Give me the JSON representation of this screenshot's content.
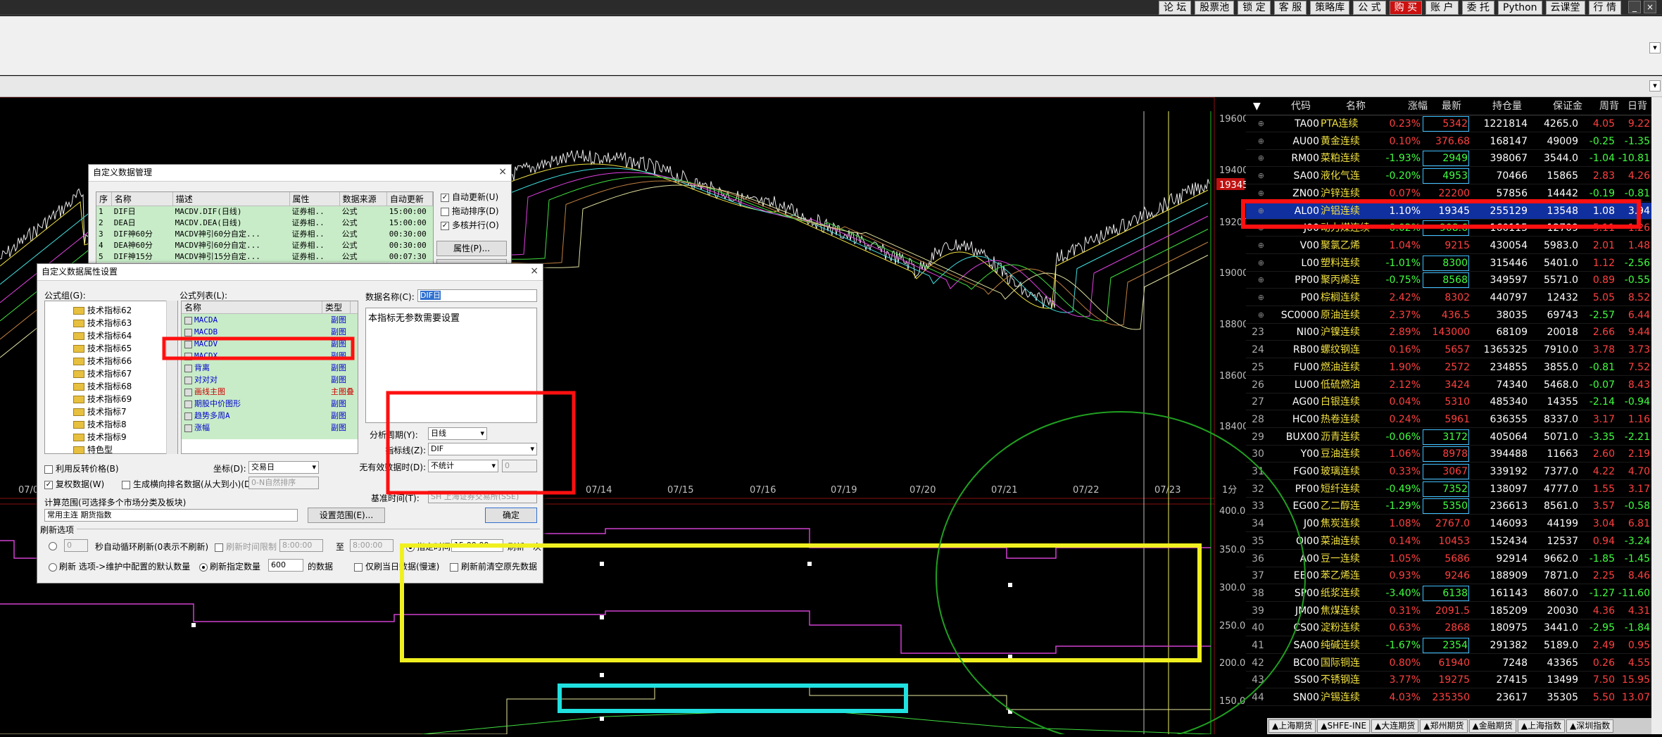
{
  "topbar": {
    "buttons": [
      "论 坛",
      "股票池",
      "锁 定",
      "客 服",
      "策略库",
      "公 式",
      "购 买",
      "账 户",
      "委 托",
      "Python",
      "云课堂",
      "行 情"
    ],
    "highlight": "购 买"
  },
  "chart": {
    "price_axis": [
      "19600",
      "19400",
      "19345",
      "19200",
      "19000",
      "18800",
      "18600",
      "18400"
    ],
    "current_price": "19345",
    "date_labels": [
      "07/05",
      "07/14",
      "07/15",
      "07/16",
      "07/19",
      "07/20",
      "07/21",
      "07/22",
      "07/23"
    ],
    "axis_unit": "1分",
    "indicator_axis": [
      "400.0",
      "350.0",
      "300.0",
      "250.0",
      "200.0",
      "150.0"
    ]
  },
  "dialog_main": {
    "title": "自定义数据管理",
    "columns": [
      "序",
      "名称",
      "描述",
      "属性",
      "数据来源",
      "自动更新"
    ],
    "rows": [
      [
        "1",
        "DIF日",
        "MACDV.DIF(日线)",
        "证券相..",
        "公式",
        "15:00:00"
      ],
      [
        "2",
        "DEA日",
        "MACDV.DEA(日线)",
        "证券相..",
        "公式",
        "15:00:00"
      ],
      [
        "3",
        "DIF神60分",
        "MACDV神引60分自定...",
        "证券相..",
        "公式",
        "00:30:00"
      ],
      [
        "4",
        "DEA神60分",
        "MACDV神引60分自定...",
        "证券相..",
        "公式",
        "00:30:00"
      ],
      [
        "5",
        "DIF神15分",
        "MACDV神引15分自定...",
        "证券相..",
        "公式",
        "00:07:30"
      ]
    ],
    "options": [
      {
        "label": "自动更新(U)",
        "checked": true
      },
      {
        "label": "拖动排序(D)",
        "checked": false
      },
      {
        "label": "多核并行(O)",
        "checked": true
      }
    ],
    "prop_button": "属性(P)..."
  },
  "dialog_prop": {
    "title": "自定义数据属性设置",
    "group_label": "公式组(G):",
    "tree": [
      "技术指标62",
      "技术指标63",
      "技术指标64",
      "技术指标65",
      "技术指标66",
      "技术指标67",
      "技术指标68",
      "技术指标69",
      "技术指标7",
      "技术指标8",
      "技术指标9",
      "特色型"
    ],
    "formula_label": "公式列表(L):",
    "formula_cols": [
      "名称",
      "类型"
    ],
    "formulas": [
      [
        "MACDA",
        "副图"
      ],
      [
        "MACDB",
        "副图"
      ],
      [
        "MACDV",
        "副图"
      ],
      [
        "MACDX",
        "副图"
      ],
      [
        "背离",
        "副图"
      ],
      [
        "对对对",
        "副图"
      ],
      [
        "画线主图",
        "主图叠"
      ],
      [
        "期股中价图形",
        "副图"
      ],
      [
        "趋势多周A",
        "副图"
      ],
      [
        "涨幅",
        "副图"
      ]
    ],
    "data_name_label": "数据名称(C):",
    "data_name_value": "DIF日",
    "desc": "本指标无参数需要设置",
    "period_label": "分析周期(Y):",
    "period_value": "日线",
    "line_label": "指标线(Z):",
    "line_value": "DIF",
    "invalid_label": "无有效数据时(D):",
    "invalid_value": "不统计",
    "invalid_num": "0",
    "use_reverse": "利用反转价格(B)",
    "coord_label": "坐标(D):",
    "coord_value": "交易日",
    "fuquan": "复权数据(W)",
    "rank": "生成横向排名数据(从大到小)(D)",
    "rank_value": "0-N自然排序",
    "base_time_label": "基准时间(T):",
    "base_time_value": "SH 上海证券交易所(SSE)",
    "range_label": "计算范围(可选择多个市场分类及板块)",
    "range_value": "常用主连 期货指数",
    "range_button": "设置范围(E)...",
    "ok_button": "确定",
    "refresh_title": "刷新选项",
    "refresh_sec_val": "0",
    "refresh_sec": "秒自动循环刷新(0表示不刷新)",
    "time_limit": "刷新时间限制",
    "t_from": "8:00:00",
    "t_to_label": "至",
    "t_to": "8:00:00",
    "assign_time": "指定时间",
    "assign_time_val": "15:00:00",
    "assign_once": "刷新一次",
    "refresh_opt": "刷新 选项->维护中配置的默认数量",
    "refresh_count": "刷新指定数量",
    "count_val": "600",
    "count_unit": "的数据",
    "only_day": "仅刷当日数据(慢速)",
    "clear_first": "刷新前清空原先数据"
  },
  "watchlist": {
    "headers": [
      "代码",
      "名称",
      "涨幅",
      "最新",
      "持仓量",
      "保证金",
      "周背",
      "日背"
    ],
    "rows": [
      [
        "",
        "TA00",
        "PTA连续",
        "0.23%",
        "5342",
        "1221814",
        "4265.0",
        "4.05",
        "9.22"
      ],
      [
        "",
        "AU00",
        "黄金连续",
        "0.10%",
        "376.68",
        "168147",
        "49009",
        "-0.25",
        "-1.35"
      ],
      [
        "",
        "RM00",
        "菜粕连续",
        "-1.93%",
        "2949",
        "398067",
        "3544.0",
        "-1.04",
        "-10.81"
      ],
      [
        "",
        "SA00",
        "液化气连",
        "-0.20%",
        "4953",
        "70466",
        "15865",
        "2.83",
        "4.26"
      ],
      [
        "",
        "ZN00",
        "沪锌连续",
        "0.07%",
        "22200",
        "57856",
        "14442",
        "-0.19",
        "-0.81"
      ],
      [
        "",
        "AL00",
        "沪铝连续",
        "1.10%",
        "19345",
        "255129",
        "13548",
        "1.08",
        "3.94"
      ],
      [
        "",
        "J00",
        "动力煤连续",
        "-0.02%",
        "908.6",
        "160115",
        "12709",
        "5.11",
        "1.26"
      ],
      [
        "",
        "V00",
        "聚氯乙烯",
        "1.04%",
        "9215",
        "430054",
        "5983.0",
        "2.01",
        "1.48"
      ],
      [
        "",
        "L00",
        "塑料连续",
        "-1.01%",
        "8300",
        "315446",
        "5401.0",
        "1.12",
        "-2.56"
      ],
      [
        "",
        "PP00",
        "聚丙烯连",
        "-0.75%",
        "8568",
        "349597",
        "5571.0",
        "0.89",
        "-0.55"
      ],
      [
        "",
        "P00",
        "棕榈连续",
        "2.42%",
        "8302",
        "440797",
        "12432",
        "5.05",
        "8.52"
      ],
      [
        "",
        "SC0000",
        "原油连续",
        "2.37%",
        "436.5",
        "38035",
        "69743",
        "-2.57",
        "6.44"
      ],
      [
        "23",
        "NI00",
        "沪镍连续",
        "2.89%",
        "143000",
        "68109",
        "20018",
        "2.66",
        "9.44"
      ],
      [
        "24",
        "RB00",
        "螺纹钢连",
        "0.16%",
        "5657",
        "1365325",
        "7910.0",
        "3.78",
        "3.73"
      ],
      [
        "25",
        "FU00",
        "燃油连续",
        "1.90%",
        "2572",
        "234855",
        "3855.0",
        "-0.81",
        "7.52"
      ],
      [
        "26",
        "LU00",
        "低硫燃油",
        "2.12%",
        "3424",
        "74340",
        "5468.0",
        "-0.07",
        "8.43"
      ],
      [
        "27",
        "AG00",
        "白银连续",
        "0.04%",
        "5310",
        "485340",
        "14355",
        "-2.14",
        "-0.94"
      ],
      [
        "28",
        "HC00",
        "热卷连续",
        "0.24%",
        "5961",
        "636355",
        "8337.0",
        "3.17",
        "1.16"
      ],
      [
        "29",
        "BUX00",
        "沥青连续",
        "-0.06%",
        "3172",
        "405064",
        "5071.0",
        "-3.35",
        "-2.21"
      ],
      [
        "30",
        "Y00",
        "豆油连续",
        "1.06%",
        "8978",
        "394488",
        "11663",
        "2.60",
        "2.19"
      ],
      [
        "31",
        "FG00",
        "玻璃连续",
        "0.33%",
        "3067",
        "339192",
        "7377.0",
        "4.22",
        "4.70"
      ],
      [
        "32",
        "PF00",
        "短纤连续",
        "-0.49%",
        "7352",
        "138097",
        "4777.0",
        "1.55",
        "3.17"
      ],
      [
        "33",
        "EG00",
        "乙二醇连",
        "-1.29%",
        "5350",
        "236613",
        "8561.0",
        "3.57",
        "-0.58"
      ],
      [
        "34",
        "J00",
        "焦炭连续",
        "1.08%",
        "2767.0",
        "146093",
        "44199",
        "3.04",
        "6.81"
      ],
      [
        "35",
        "OI00",
        "菜油连续",
        "0.14%",
        "10453",
        "152434",
        "12537",
        "0.94",
        "-3.24"
      ],
      [
        "36",
        "A00",
        "豆一连续",
        "1.05%",
        "5686",
        "92914",
        "9662.0",
        "-1.85",
        "-1.45"
      ],
      [
        "37",
        "EB00",
        "苯乙烯连",
        "0.93%",
        "9246",
        "188909",
        "7871.0",
        "2.25",
        "8.46"
      ],
      [
        "38",
        "SP00",
        "纸浆连续",
        "-3.40%",
        "6138",
        "161143",
        "8607.0",
        "-1.27",
        "-11.60"
      ],
      [
        "39",
        "JM00",
        "焦煤连续",
        "0.31%",
        "2091.5",
        "185209",
        "20030",
        "4.36",
        "4.31"
      ],
      [
        "40",
        "CS00",
        "淀粉连续",
        "0.63%",
        "2868",
        "180975",
        "3441.0",
        "-2.95",
        "-1.84"
      ],
      [
        "41",
        "SA00",
        "纯碱连续",
        "-1.67%",
        "2354",
        "291382",
        "5189.0",
        "2.49",
        "0.95"
      ],
      [
        "42",
        "BC00",
        "国际铜连",
        "0.80%",
        "61940",
        "7248",
        "43365",
        "0.26",
        "4.55"
      ],
      [
        "43",
        "SS00",
        "不锈钢连",
        "3.77%",
        "19275",
        "27415",
        "13499",
        "7.50",
        "15.95"
      ],
      [
        "44",
        "SN00",
        "沪锡连续",
        "4.03%",
        "235350",
        "23617",
        "35305",
        "5.50",
        "13.07"
      ]
    ]
  },
  "bottom_tabs": [
    "上海期货",
    "SHFE-INE",
    "大连期货",
    "郑州期货",
    "金融期货",
    "上海指数",
    "深圳指数"
  ]
}
